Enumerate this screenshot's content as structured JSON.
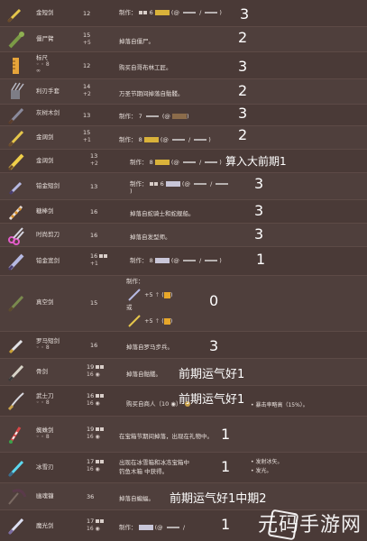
{
  "rows": [
    {
      "name": "金短剑",
      "dmg": "12",
      "desc": "制作：",
      "count": "3"
    },
    {
      "name": "僵尸臂",
      "dmg": "15",
      "desc": "掉落自僵尸。",
      "count": "2"
    },
    {
      "name": "标尺",
      "dmg": "12",
      "desc": "购买自哥布林工匠。",
      "count": "3"
    },
    {
      "name": "利刃手套",
      "dmg": "14",
      "desc": "万圣节期间掉落自骷髅。",
      "count": "2"
    },
    {
      "name": "灰树木剑",
      "dmg": "13",
      "desc": "制作：",
      "count": "3"
    },
    {
      "name": "金阔剑",
      "dmg": "15",
      "desc": "制作：",
      "count": "2"
    },
    {
      "name": "金阔剑",
      "dmg": "13",
      "desc": "制作：",
      "count": "算入大前期1"
    },
    {
      "name": "铂金短剑",
      "dmg": "13",
      "desc": "制作：",
      "count": "3"
    },
    {
      "name": "糖棒剑",
      "dmg": "16",
      "desc": "掉落自蛇骑士和蛇舰船。",
      "count": "3"
    },
    {
      "name": "时尚剪刀",
      "dmg": "16",
      "desc": "掉落自发型师。",
      "count": "3"
    },
    {
      "name": "铂金宽剑",
      "dmg": "16",
      "desc": "制作：",
      "count": "1"
    },
    {
      "name": "真空剑",
      "dmg": "15",
      "desc": "制作：",
      "count": "0"
    },
    {
      "name": "罗马短剑",
      "dmg": "16",
      "desc": "掉落自罗马步兵。",
      "count": "3"
    },
    {
      "name": "骨剑",
      "dmg": "19",
      "desc": "掉落自骷髅。",
      "count": "前期运气好1"
    },
    {
      "name": "武士刀",
      "dmg": "16",
      "desc": "购买自商人（10 ◉）",
      "count": "前期运气好1"
    },
    {
      "name": "蜘蛛剑",
      "dmg": "19",
      "desc": "在宝箱节期间掉落，出现在礼物中。",
      "count": "1"
    },
    {
      "name": "冰雪刃",
      "dmg": "17",
      "desc": "出现在冰雪箱和冰冻宝箱中",
      "count": "1"
    },
    {
      "name": "幽魂镰",
      "dmg": "36",
      "desc": "掉落自蝙蝠。",
      "count": "前期运气好1中期2"
    },
    {
      "name": "魔光剑",
      "dmg": "17",
      "desc": "制作：",
      "count": "1"
    }
  ],
  "extra": {
    "vacuum_line1": "制作：",
    "vacuum_line2": "+5",
    "vacuum_line3": "或",
    "katana_note": "• 暴击率略高（15%）。",
    "ice_note1": "• 发射冰矢。",
    "ice_note2": "• 发光。",
    "ice_desc2": "钓鱼木箱 中获得。"
  },
  "watermark": {
    "text": "元码手游网"
  }
}
